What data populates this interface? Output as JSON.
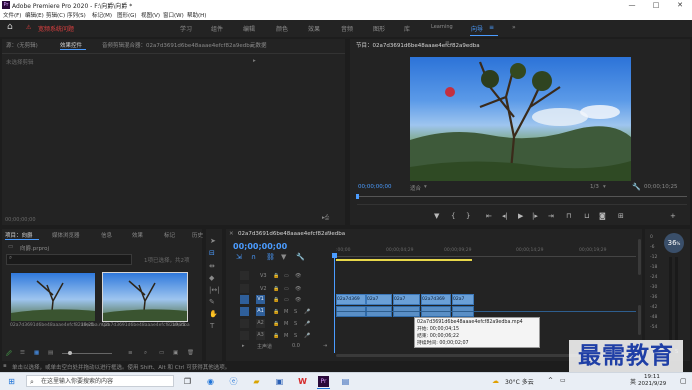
{
  "window": {
    "title": "Adobe Premiere Pro 2020 - F:\\向爵\\向爵 *",
    "controls": [
      "—",
      "□",
      "✕"
    ]
  },
  "menu": [
    "文件(F)",
    "编辑(E)",
    "剪辑(C)",
    "序列(S)",
    "标记(M)",
    "图形(G)",
    "视图(V)",
    "窗口(W)",
    "帮助(H)"
  ],
  "workspace": {
    "home_icon": "home-icon",
    "alert": "宽频系统问题",
    "tabs": [
      "学习",
      "组件",
      "编辑",
      "颜色",
      "效果",
      "音频",
      "图形",
      "库",
      "Learning",
      "向导",
      "≡",
      "»"
    ],
    "active_tab": "向导"
  },
  "effect_controls": {
    "tabs": [
      "源：(无剪辑)",
      "效果控件",
      "音频剪辑混合器：02a7d3691d6be48aaae4efcf82a9edba",
      "元数据"
    ],
    "active_tab": "效果控件",
    "empty_msg": "未选择剪辑",
    "timecode": "00;00;00;00"
  },
  "program": {
    "title": "节目：02a7d3691d6be48aaae4efcf82a9edba",
    "timecode": "00;00;00;00",
    "fit": "适合",
    "ratio": "1/3",
    "duration": "00;00;10;25"
  },
  "project": {
    "tabs": [
      "项目：向爵",
      "媒体浏览器",
      "信息",
      "效果",
      "标记",
      "历史"
    ],
    "file": "向爵.prproj",
    "selection": "1项已选择，共2项",
    "items": [
      {
        "name": "02a7d3691d6be48aaae4efcf82a9edba.mp4",
        "duration": "10;25"
      },
      {
        "name": "02a7d3691d6be48aaae4efcf82a9edba",
        "duration": "10;25"
      }
    ]
  },
  "timeline": {
    "tab": "02a7d3691d6be48aaae4efcf82a9edba",
    "timecode": "00;00;00;00",
    "ruler": [
      ":00;00",
      "00;00;04;29",
      "00;00;09;29",
      "00;00;14;29",
      "00;00;19;29"
    ],
    "video_tracks": [
      "V3",
      "V2",
      "V1"
    ],
    "audio_tracks": [
      "A1",
      "A2",
      "A3"
    ],
    "master": "主声道",
    "master_value": "0.0",
    "clip_labels": [
      "02a7d369",
      "02a7",
      "02a7",
      "02a7d369",
      "02a7"
    ],
    "tooltip": {
      "name": "02a7d3691d6be48aaae4efcf82a9edba.mp4",
      "start": "开始: 00;00;04;15",
      "end": "结束: 00;00;06;22",
      "duration": "持续时间: 00;00;02;07"
    }
  },
  "meters": {
    "labels": [
      "0",
      "-6",
      "-12",
      "-18",
      "-24",
      "-30",
      "-36",
      "-42",
      "-48",
      "-54"
    ],
    "badge": "36",
    "badge_unit": "%"
  },
  "status": {
    "hint": "单击以选择，或单击空白处并拖动以进行框选。使用 Shift、Alt 和 Ctrl 可获得其他选项。"
  },
  "taskbar": {
    "search_placeholder": "在这里输入你要搜索的内容",
    "weather": "30°C  多云",
    "ime": "英",
    "time": "19:11",
    "date": "2021/9/29"
  },
  "watermark": "最需教育",
  "colors": {
    "accent": "#4b9cff",
    "alert": "#e04040",
    "clip": "#6aa0d8"
  }
}
